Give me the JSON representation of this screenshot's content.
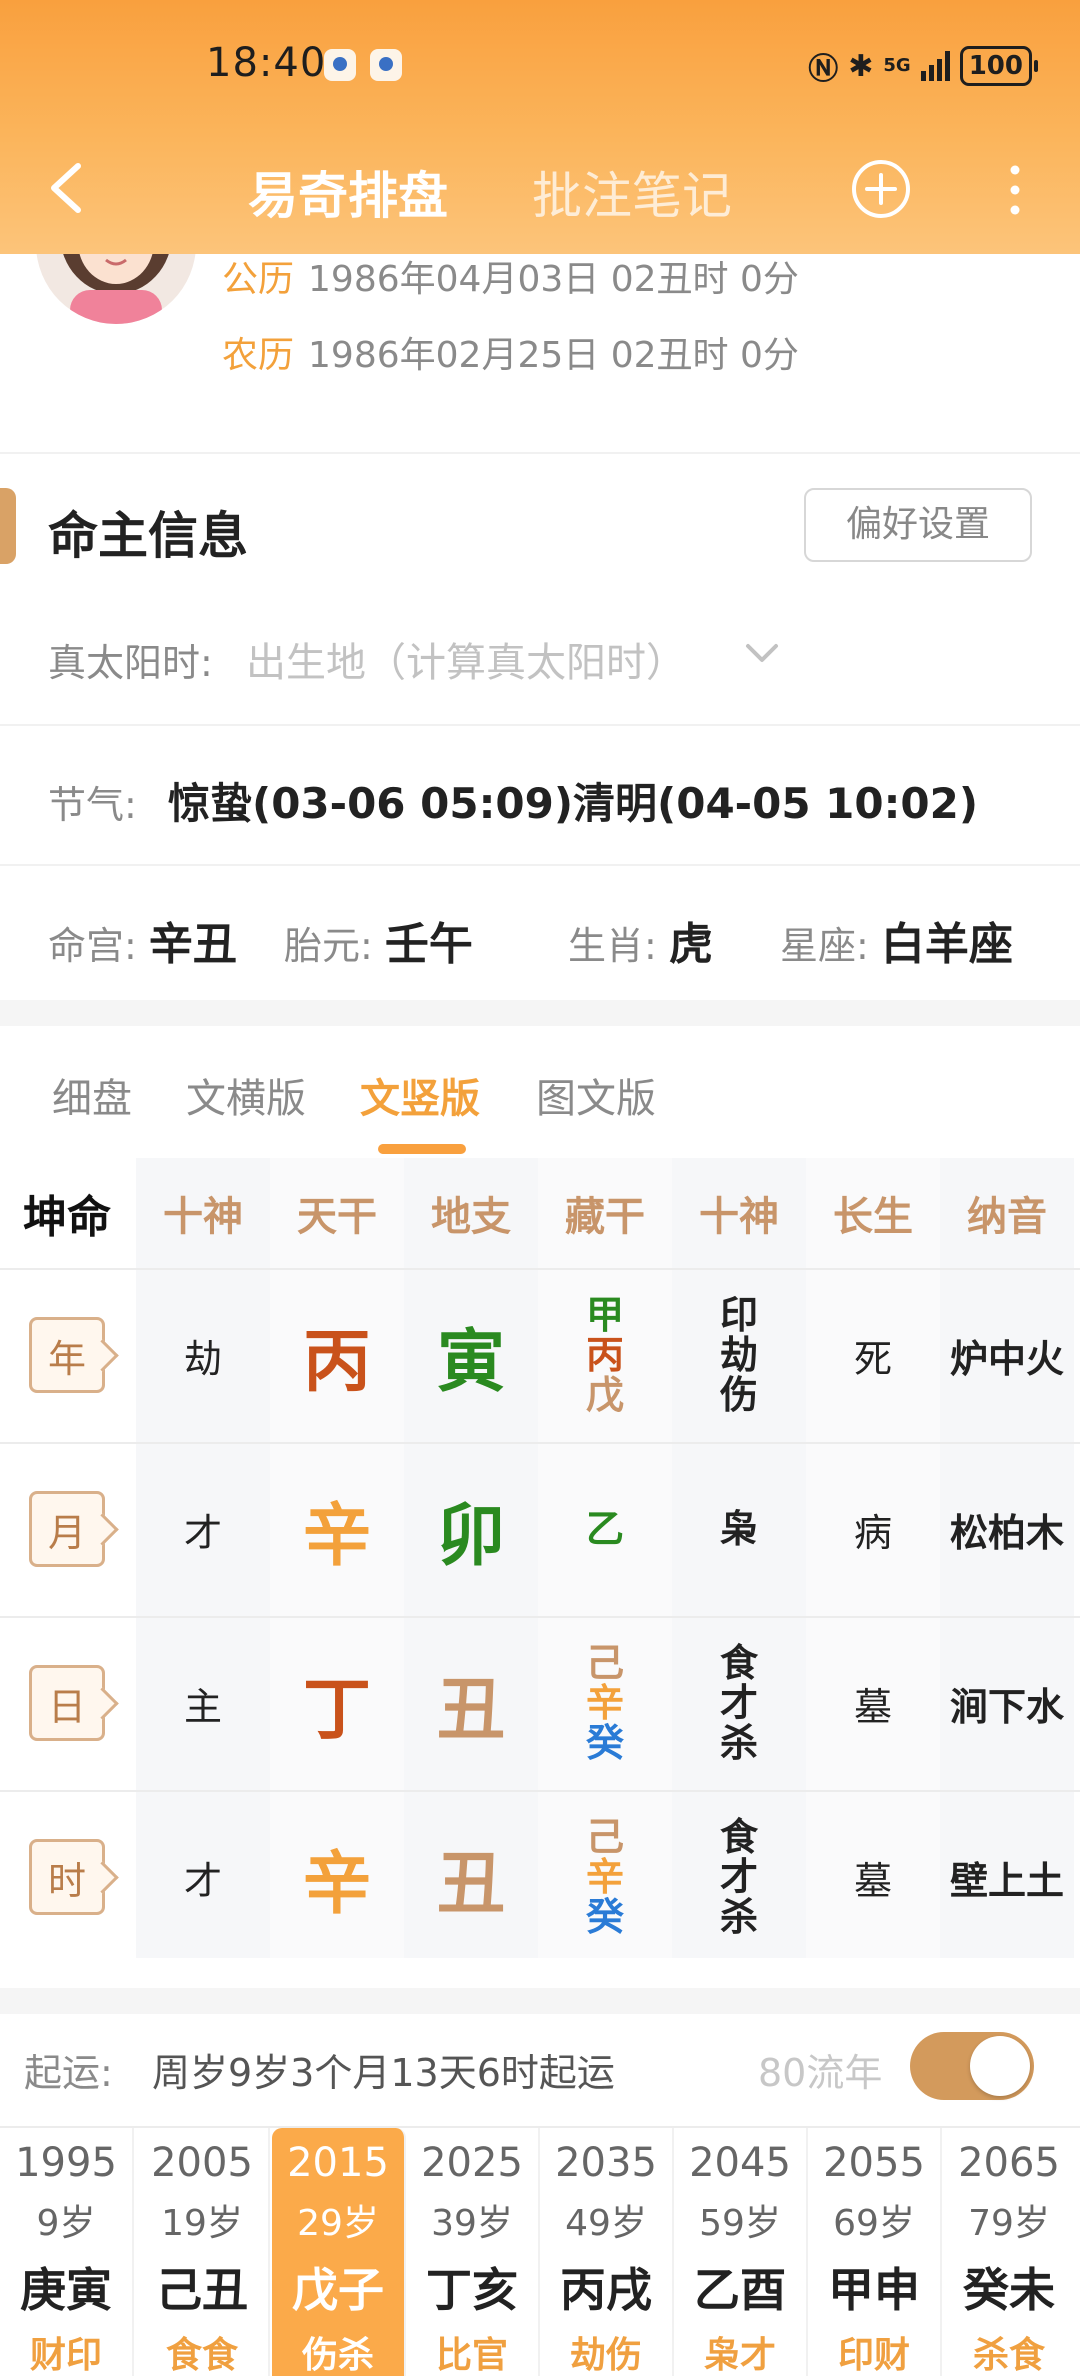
{
  "status_bar": {
    "time": "18:40",
    "network": "5G",
    "battery": "100"
  },
  "nav": {
    "tab_active": "易奇排盘",
    "tab_other": "批注笔记"
  },
  "profile": {
    "solar_label": "公历",
    "solar_value": "1986年04月03日 02丑时 0分",
    "lunar_label": "农历",
    "lunar_value": "1986年02月25日 02丑时 0分"
  },
  "info": {
    "title": "命主信息",
    "pref_button": "偏好设置",
    "solar_time_label": "真太阳时:",
    "solar_time_value": "出生地（计算真太阳时）",
    "jieqi_label": "节气:",
    "jieqi_value": "惊蛰(03-06 05:09)清明(04-05 10:02)",
    "minggong_label": "命宫:",
    "minggong_value": "辛丑",
    "taiyuan_label": "胎元:",
    "taiyuan_value": "壬午",
    "shengxiao_label": "生肖:",
    "shengxiao_value": "虎",
    "xingzuo_label": "星座:",
    "xingzuo_value": "白羊座"
  },
  "view_tabs": [
    "细盘",
    "文横版",
    "文竖版",
    "图文版"
  ],
  "active_view_tab": "文竖版",
  "chart": {
    "headers": [
      "坤命",
      "十神",
      "天干",
      "地支",
      "藏干",
      "十神",
      "长生",
      "纳音"
    ],
    "rows": [
      {
        "pillar": "年",
        "shishen": "劫",
        "gan": "丙",
        "zhi": "寅",
        "canggan": [
          "甲",
          "丙",
          "戊"
        ],
        "shishen2": [
          "印",
          "劫",
          "伤"
        ],
        "changsheng": "死",
        "nayin": "炉中火"
      },
      {
        "pillar": "月",
        "shishen": "才",
        "gan": "辛",
        "zhi": "卯",
        "canggan": [
          "乙"
        ],
        "shishen2": [
          "枭"
        ],
        "changsheng": "病",
        "nayin": "松柏木"
      },
      {
        "pillar": "日",
        "shishen": "主",
        "gan": "丁",
        "zhi": "丑",
        "canggan": [
          "己",
          "辛",
          "癸"
        ],
        "shishen2": [
          "食",
          "才",
          "杀"
        ],
        "changsheng": "墓",
        "nayin": "涧下水"
      },
      {
        "pillar": "时",
        "shishen": "才",
        "gan": "辛",
        "zhi": "丑",
        "canggan": [
          "己",
          "辛",
          "癸"
        ],
        "shishen2": [
          "食",
          "才",
          "杀"
        ],
        "changsheng": "墓",
        "nayin": "壁上土"
      }
    ]
  },
  "colors": {
    "wood": "#2a8a20",
    "fire": "#c9521b",
    "earth": "#c8956a",
    "metal": "#f3a13b",
    "water": "#2a7bd6",
    "accent": "#f9a03e"
  },
  "qiyun": {
    "label": "起运:",
    "value": "周岁9岁3个月13天6时起运",
    "liunian_label": "80流年",
    "toggle_on": true
  },
  "dayun": [
    {
      "year": "1995",
      "age": "9岁",
      "ganzhi": "庚寅",
      "shishen": "财印"
    },
    {
      "year": "2005",
      "age": "19岁",
      "ganzhi": "己丑",
      "shishen": "食食"
    },
    {
      "year": "2015",
      "age": "29岁",
      "ganzhi": "戊子",
      "shishen": "伤杀",
      "active": true
    },
    {
      "year": "2025",
      "age": "39岁",
      "ganzhi": "丁亥",
      "shishen": "比官"
    },
    {
      "year": "2035",
      "age": "49岁",
      "ganzhi": "丙戌",
      "shishen": "劫伤"
    },
    {
      "year": "2045",
      "age": "59岁",
      "ganzhi": "乙酉",
      "shishen": "枭才"
    },
    {
      "year": "2055",
      "age": "69岁",
      "ganzhi": "甲申",
      "shishen": "印财"
    },
    {
      "year": "2065",
      "age": "79岁",
      "ganzhi": "癸未",
      "shishen": "杀食"
    }
  ]
}
